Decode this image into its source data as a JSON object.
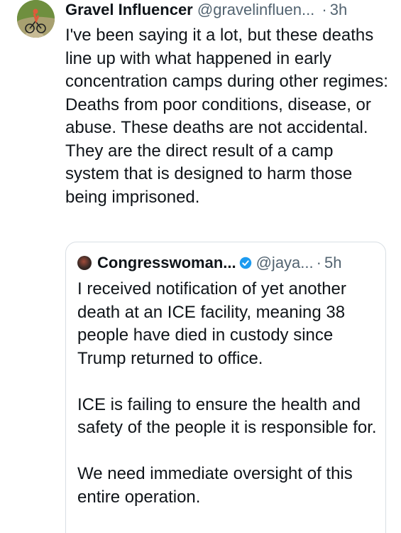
{
  "post": {
    "author_name": "Gravel Influencer",
    "author_handle": "@gravelinfluen...",
    "separator": "·",
    "time": "3h",
    "text": "I've been saying it a lot, but these deaths line up with what happened in early concentration camps during other regimes: Deaths from poor conditions, disease, or abuse. These deaths are not accidental. They are the direct result of a camp system that is designed to harm those being imprisoned.",
    "avatar_icon": "cyclist-avatar"
  },
  "quote": {
    "author_name": "Congresswoman...",
    "author_handle": "@jaya...",
    "separator": "·",
    "time": "5h",
    "verified_icon": "verified-badge-icon",
    "paragraphs": [
      "I received notification of yet another death at an ICE facility, meaning 38 people have died in custody since Trump returned to office.",
      "ICE is failing to ensure the health and safety of the people it is responsible for.",
      "We need immediate oversight of this entire operation."
    ]
  },
  "colors": {
    "text_primary": "#0f1419",
    "text_secondary": "#536471",
    "border": "#d9dfe4",
    "verified_blue": "#1d9bf0"
  }
}
